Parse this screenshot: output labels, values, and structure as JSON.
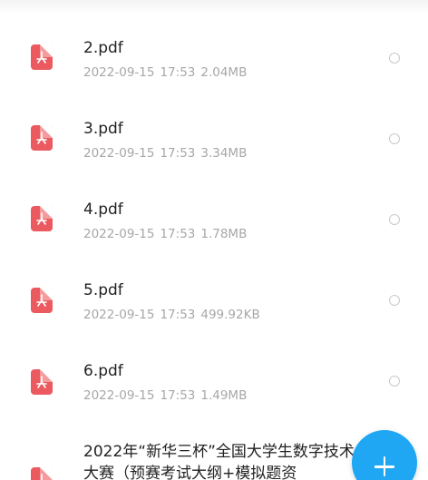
{
  "files": [
    {
      "name": "2.pdf",
      "date": "2022-09-15",
      "time": "17:53",
      "size": "2.04MB",
      "icon": "pdf-icon"
    },
    {
      "name": "3.pdf",
      "date": "2022-09-15",
      "time": "17:53",
      "size": "3.34MB",
      "icon": "pdf-icon"
    },
    {
      "name": "4.pdf",
      "date": "2022-09-15",
      "time": "17:53",
      "size": "1.78MB",
      "icon": "pdf-icon"
    },
    {
      "name": "5.pdf",
      "date": "2022-09-15",
      "time": "17:53",
      "size": "499.92KB",
      "icon": "pdf-icon"
    },
    {
      "name": "6.pdf",
      "date": "2022-09-15",
      "time": "17:53",
      "size": "1.49MB",
      "icon": "pdf-icon"
    },
    {
      "name": "2022年“新华三杯”全国大学生数字技术大赛（预赛考试大纲+模拟题资",
      "icon": "pdf-icon"
    }
  ],
  "fab": {
    "icon": "plus-icon"
  },
  "colors": {
    "accent": "#1fa7f3",
    "pdf": "#ea5a5f"
  }
}
